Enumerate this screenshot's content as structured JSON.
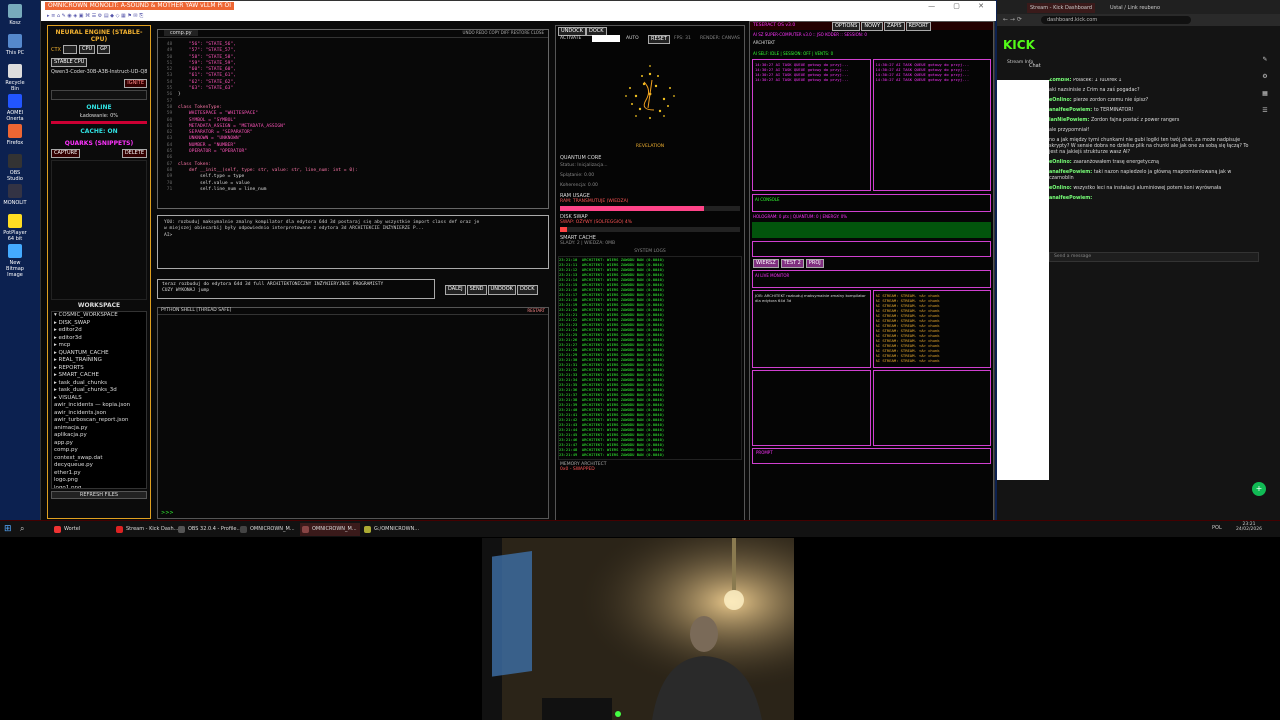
{
  "app": {
    "title": "OMNICROWN MONOLIT: A-SOUND & MOTHER YAW vLLM Pi OI"
  },
  "left": {
    "engine_title": "NEURAL ENGINE (STABLE-CPU)",
    "ctx_label": "CTX",
    "model": "Qwen3-Coder-30B-A3B-Instruct-UD-Q8",
    "ignite": "IGNITE",
    "status": "ONLINE",
    "loading": "Ładowanie: 0%",
    "cache": "CACHE: ON",
    "quarks_title": "QUARKS (SNIPPETS)",
    "capture": "CAPTURE",
    "delete": "DELETE",
    "workspace_title": "WORKSPACE",
    "tree": [
      "COSMIC_WORKSPACE",
      "DISK_SWAP",
      "editor2d",
      "editor3d",
      "mcp",
      "QUANTUM_CACHE",
      "REAL_TRAINING",
      "REPORTS",
      "SMART_CACHE",
      "task_dual_chunks",
      "task_dual_chunks_3d",
      "VISUALS",
      "awir_incidents — kopia.json",
      "awir_incidents.json",
      "awir_turboscan_report.json",
      "animacja.py",
      "aplikacja.py",
      "app.py",
      "comp.py",
      "context_swap.dat",
      "decyqueue.py",
      "ether1.py",
      "logo.png",
      "logo1.png"
    ],
    "refresh": "REFRESH FILES"
  },
  "editor": {
    "tab": "comp.py",
    "toolbar": [
      "UNDO",
      "REDO",
      "COPY",
      "DIFF",
      "RESTORE",
      "CLOSE"
    ],
    "lines": [
      "    \"56\": \"STATE_56\",",
      "    \"57\": \"STATE_57\",",
      "    \"58\": \"STATE_58\",",
      "    \"59\": \"STATE_59\",",
      "    \"60\": \"STATE_60\",",
      "    \"61\": \"STATE_61\",",
      "    \"62\": \"STATE_62\",",
      "    \"63\": \"STATE_63\"",
      "}",
      "",
      "class TokenType:",
      "    WHITESPACE = \"WHITESPACE\"",
      "    SYMBOL = \"SYMBOL\"",
      "    METADATA_ASSIGN = \"METADATA_ASSIGN\"",
      "    SEPARATOR = \"SEPARATOR\"",
      "    UNKNOWN = \"UNKNOWN\"",
      "    NUMBER = \"NUMBER\"",
      "    OPERATOR = \"OPERATOR\"",
      "",
      "class Token:",
      "    def __init__(self, type: str, value: str, line_num: int = 0):",
      "        self.type = type",
      "        self.value = value",
      "        self.line_num = line_num"
    ],
    "line_start": 48
  },
  "prompt": {
    "text": "YOU: rozbuduj maksymalnie zmalny kompilator dla edytora 64d 3d postaraj się aby wszystkie import class def oraz je\nw miejszej obiecarbij były odpowiednio interpretowane z edytora 3d ARCHITEKCIE INŻYNIERZE P...\nAI>"
  },
  "command": {
    "text": "teraz rozbuduj do edytora 64d 3d full ARCHITEKTONICZNY INŻYNIERYJNIE PROGRAMISTY\nCUZY WYKONAJ jump",
    "buttons": [
      "DALEJ",
      "SEND",
      "UNDOOK",
      "DOCK"
    ]
  },
  "shell": {
    "title": "PYTHON SHELL [THREAD SAFE]",
    "restart": "RESTART",
    "prompt": ">>>"
  },
  "center": {
    "undock": "UNDOCK",
    "dock": "DOCK",
    "activate": "ACTIVATE",
    "auto": "AUTO",
    "reset": "RESET",
    "fps": "FPS: 31",
    "render": "RENDER: CANVAS",
    "revelation": "REVELATION",
    "quantum_title": "QUANTUM CORE",
    "status": "Status: Inicjalizacja...",
    "splatanie": "Splątanie: 0.00",
    "koherencja": "Koherencja: 0.00",
    "ram_title": "RAM USAGE",
    "ram_text": "RAM: TRANSMUTUJE (WIEDZA)",
    "ram_value": 0.8,
    "disk_title": "DISK SWAP",
    "disk_text": "SWAP: OŻYWY (SOLFEGGIO) 4%",
    "disk_value": 0.04,
    "smart_title": "SMART CACHE",
    "smart_text": "SLADY: 2 | WIEDZA: 0MB",
    "logs_title": "SYSTEM LOGS",
    "log_line": "ARCHITEKT: WIERS ZAWODU BAN (0.0040)",
    "memory": "MEMORY ARCHITECT",
    "swapped": "0x0 - SWAPPED"
  },
  "right": {
    "header": "TESERACT OS v3.0",
    "tabs": [
      "OPTIONS",
      "NOWY",
      "ZAPIS",
      "REPORT"
    ],
    "sub": "AI SZ SUPER-COMPUTER v3.0 :: JSO KODER :: SESSION: 0",
    "architekt": "ARCHITEKT",
    "self": "AI SELF: IDLE | SESSION: OFF | VENTS: 0",
    "log_lines": [
      "14:30:27 AI TASK QUEUE gotowy do przyj...",
      "14:30:27 AI TASK QUEUE gotowy do przyj...",
      "14:30:27 AI TASK QUEUE gotowy do przyj...",
      "14:30:27 AI TASK QUEUE gotowy do przyj..."
    ],
    "critical": "AI CONSOLE",
    "hologram": "HOLOGRAM: 0 pts | QUANTUM: 0 | ENERGY: 0%",
    "buttons": [
      "WIERSZ",
      "TEST 2",
      "PROJ"
    ],
    "projekt": "AI LIVE MONITOR",
    "job": "JOB: ARCHITEKT rozbuduj maksymalnie zmalny kompilator dla edytora 64d 3d",
    "stream": "AI STREAM: STREAM. <A> chunk",
    "prompt_label": "PROMPT"
  },
  "browser": {
    "tabs": [
      "Stream - Kick Dashboard",
      "Ustal / Link reubeno"
    ],
    "url": "dashboard.kick.com",
    "brand": "KICK",
    "stream_info": "Stream Info",
    "chat_title": "Chat",
    "messages": [
      {
        "user": "ZombiR",
        "text": "Polacek: 1 TuDirek 1"
      },
      {
        "user": "",
        "text": "aki nazsinisie z Crim na zaś pogadac?"
      },
      {
        "user": "eOnlino",
        "text": "pierze zordon czemu nie śpisz?"
      },
      {
        "user": "analfeePowiem",
        "text": "to TERMINATOR!"
      },
      {
        "user": "ianNiePowiem",
        "text": "Zordon fajna postać z power rangers"
      },
      {
        "user": "",
        "text": "ale przypomniał!"
      },
      {
        "user": "",
        "text": "no a jak między tymi chunkami nie gubi logiki ten twój chat, za może nadpisuje skrypty? W sensie dobra no dzielisz plik na chunki ale jak one za sobą się łączą? To jest na jakiejś strukturze wasz AI?"
      },
      {
        "user": "eOnlino",
        "text": "zaaranżowałem trasę energetyczną"
      },
      {
        "user": "analfeePowiem",
        "text": "taki nazon napiedzelo ja główną rnapromieniowaną jak w czarnoblin"
      },
      {
        "user": "eOnlino",
        "text": "wszystko leci na instalacji aluminiowej potem koni wyrównała"
      },
      {
        "user": "analfeePowiem",
        "text": ""
      }
    ],
    "send_placeholder": "Send a message"
  },
  "desk_icons": [
    {
      "label": "Kosz",
      "color": "#7ab"
    },
    {
      "label": "This PC",
      "color": "#58c"
    },
    {
      "label": "Recycle Bin",
      "color": "#ddd"
    },
    {
      "label": "AOMEI Onerta",
      "color": "#25f"
    },
    {
      "label": "Firefox",
      "color": "#e63"
    },
    {
      "label": "OBS Studio",
      "color": "#333"
    },
    {
      "label": "MONOLIT",
      "color": "#334"
    },
    {
      "label": "PotPlayer 64 bit",
      "color": "#fd2"
    },
    {
      "label": "New Bitmap Image",
      "color": "#4af"
    }
  ],
  "taskbar": {
    "items": [
      "Wortel",
      "Stream - Kick Dash...",
      "OBS 32.0.4 - Profile...",
      "OMNICROWN_M...",
      "OMNICROWN_M...",
      "G:/OMNICROWN..."
    ],
    "tray_lang": "POL",
    "time": "23:21",
    "date": "24/02/2026"
  }
}
